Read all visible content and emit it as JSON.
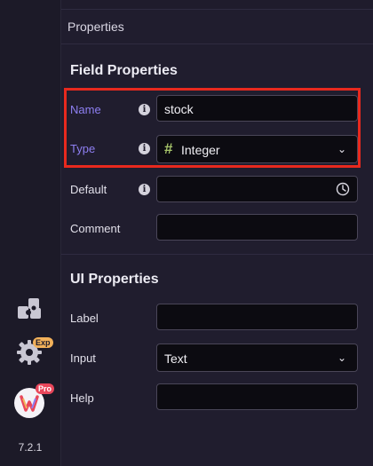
{
  "sidebar": {
    "plugins_icon": "puzzle-icon",
    "settings_icon": "gear-icon",
    "settings_badge": "Exp",
    "app_icon": "app-logo-icon",
    "app_badge": "Pro",
    "version": "7.2.1"
  },
  "panel": {
    "title": "Properties"
  },
  "field_properties": {
    "heading": "Field Properties",
    "name": {
      "label": "Name",
      "value": "stock"
    },
    "type": {
      "label": "Type",
      "icon": "hash-icon",
      "icon_glyph": "#",
      "value": "Integer"
    },
    "default": {
      "label": "Default",
      "value": ""
    },
    "comment": {
      "label": "Comment",
      "value": ""
    }
  },
  "ui_properties": {
    "heading": "UI Properties",
    "label": {
      "label": "Label",
      "value": ""
    },
    "input": {
      "label": "Input",
      "value": "Text"
    },
    "help": {
      "label": "Help",
      "value": ""
    }
  },
  "colors": {
    "accent": "#8e7ff2",
    "highlight": "#e8291e",
    "exp_badge": "#f2b15a",
    "pro_badge": "#e8465a"
  }
}
